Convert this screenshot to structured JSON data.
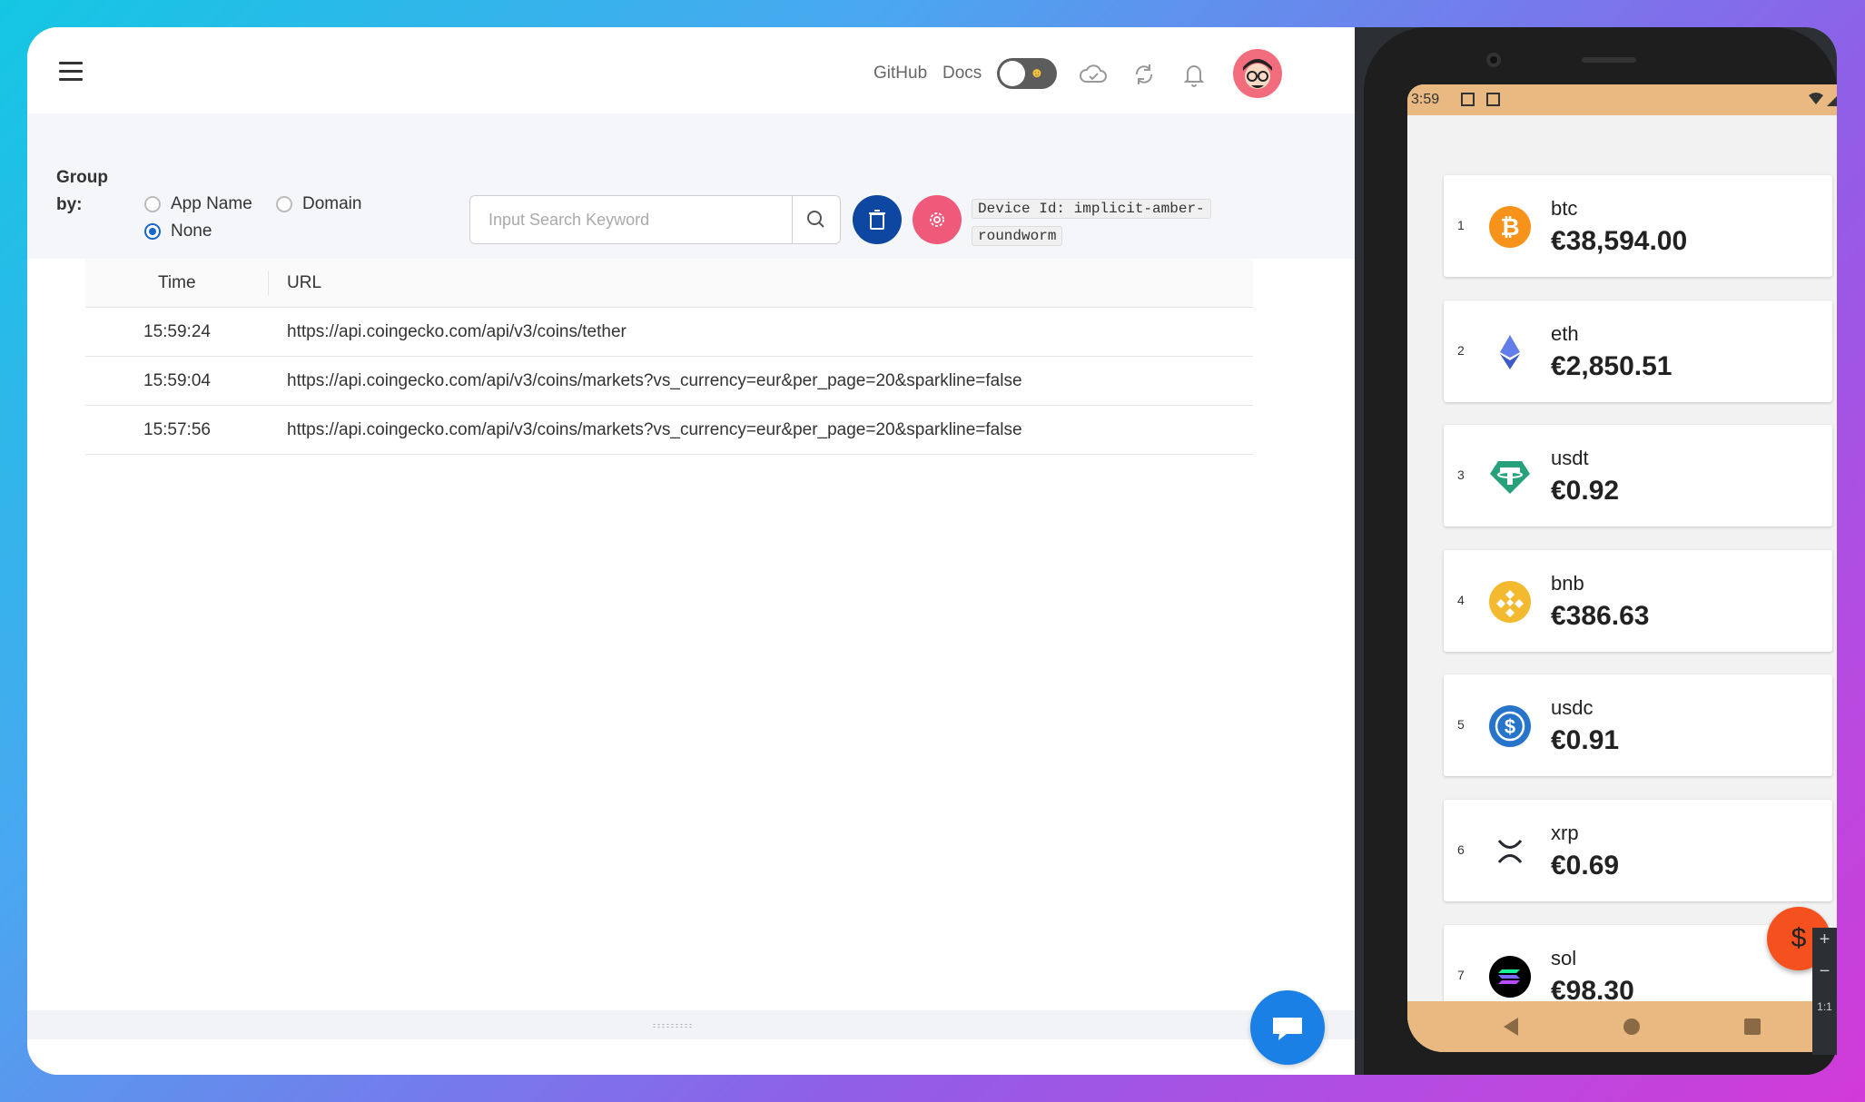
{
  "topbar": {
    "links": [
      "GitHub",
      "Docs"
    ]
  },
  "toolbar": {
    "group_by_label": "Group by:",
    "group_options": [
      {
        "label": "App Name",
        "selected": false
      },
      {
        "label": "Domain",
        "selected": false
      },
      {
        "label": "None",
        "selected": true
      }
    ],
    "search_placeholder": "Input Search Keyword",
    "search_value": "",
    "device_id": "Device Id: implicit-amber-roundworm",
    "device_id_line1": "Device Id: implicit-amber-",
    "device_id_line2": "roundworm",
    "delete_color": "#0d47a1",
    "settings_color": "#ef5a7a"
  },
  "table": {
    "columns": [
      "Time",
      "URL"
    ],
    "rows": [
      {
        "time": "15:59:24",
        "url": "https://api.coingecko.com/api/v3/coins/tether"
      },
      {
        "time": "15:59:04",
        "url": "https://api.coingecko.com/api/v3/coins/markets?vs_currency=eur&per_page=20&sparkline=false"
      },
      {
        "time": "15:57:56",
        "url": "https://api.coingecko.com/api/v3/coins/markets?vs_currency=eur&per_page=20&sparkline=false"
      }
    ]
  },
  "phone": {
    "status_time": "3:59",
    "fab_label": "$",
    "coins": [
      {
        "rank": "1",
        "symbol": "btc",
        "price": "€38,594.00",
        "icon": "bitcoin-icon",
        "color": "#f7931a"
      },
      {
        "rank": "2",
        "symbol": "eth",
        "price": "€2,850.51",
        "icon": "ethereum-icon",
        "color": "#627eea"
      },
      {
        "rank": "3",
        "symbol": "usdt",
        "price": "€0.92",
        "icon": "tether-icon",
        "color": "#26a17b"
      },
      {
        "rank": "4",
        "symbol": "bnb",
        "price": "€386.63",
        "icon": "bnb-icon",
        "color": "#f3ba2f"
      },
      {
        "rank": "5",
        "symbol": "usdc",
        "price": "€0.91",
        "icon": "usdc-icon",
        "color": "#2775ca"
      },
      {
        "rank": "6",
        "symbol": "xrp",
        "price": "€0.69",
        "icon": "xrp-icon",
        "color": "#23292f"
      },
      {
        "rank": "7",
        "symbol": "sol",
        "price": "€98.30",
        "icon": "solana-icon",
        "color": "#000000"
      }
    ]
  }
}
